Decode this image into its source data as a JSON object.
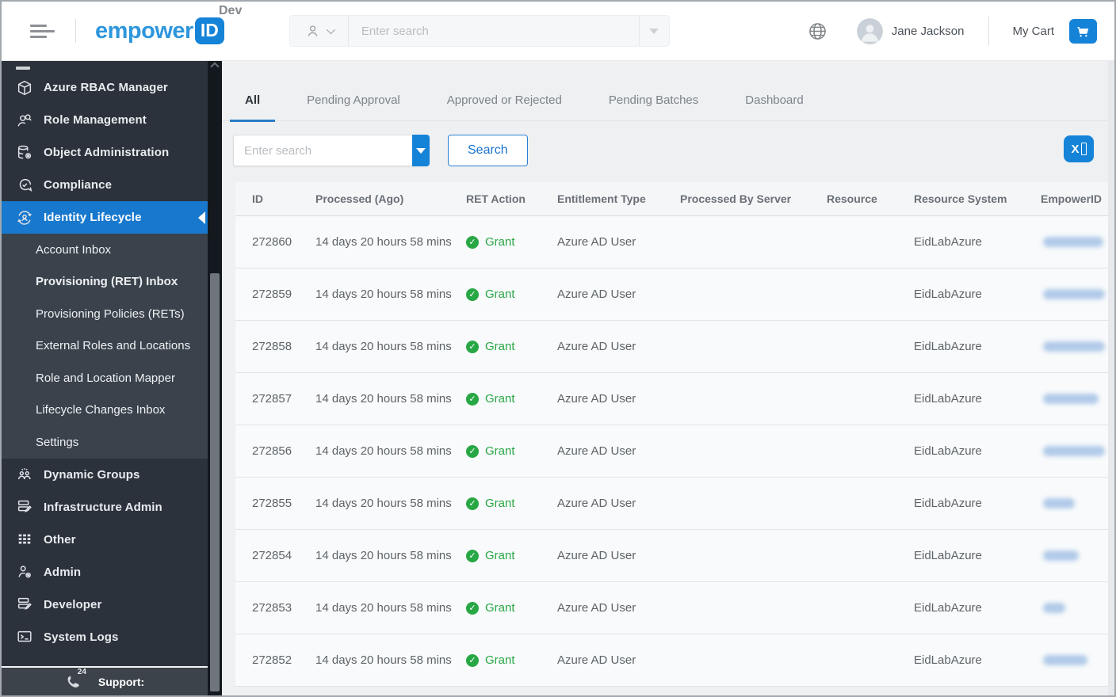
{
  "header": {
    "env_label": "Dev",
    "brand": {
      "text": "empower",
      "badge": "ID"
    },
    "search": {
      "placeholder": "Enter search"
    },
    "user": {
      "name": "Jane Jackson"
    },
    "cart_label": "My Cart"
  },
  "sidebar": {
    "items": [
      {
        "label": "Azure RBAC Manager",
        "icon": "cube-icon",
        "kind": "top"
      },
      {
        "label": "Role Management",
        "icon": "role-search-icon",
        "kind": "top"
      },
      {
        "label": "Object Administration",
        "icon": "database-gear-icon",
        "kind": "top"
      },
      {
        "label": "Compliance",
        "icon": "chat-check-icon",
        "kind": "top"
      },
      {
        "label": "Identity Lifecycle",
        "icon": "identity-cycle-icon",
        "kind": "top",
        "selected": true
      },
      {
        "label": "Account Inbox",
        "kind": "sub"
      },
      {
        "label": "Provisioning (RET) Inbox",
        "kind": "sub",
        "active": true
      },
      {
        "label": "Provisioning Policies (RETs)",
        "kind": "sub"
      },
      {
        "label": "External Roles and Locations",
        "kind": "sub"
      },
      {
        "label": "Role and Location Mapper",
        "kind": "sub"
      },
      {
        "label": "Lifecycle Changes Inbox",
        "kind": "sub"
      },
      {
        "label": "Settings",
        "kind": "sub"
      },
      {
        "label": "Dynamic Groups",
        "icon": "dynamic-groups-icon",
        "kind": "top"
      },
      {
        "label": "Infrastructure Admin",
        "icon": "server-edit-icon",
        "kind": "top"
      },
      {
        "label": "Other",
        "icon": "grid-icon",
        "kind": "top"
      },
      {
        "label": "Admin",
        "icon": "user-gear-icon",
        "kind": "top"
      },
      {
        "label": "Developer",
        "icon": "server-edit-icon",
        "kind": "top"
      },
      {
        "label": "System Logs",
        "icon": "terminal-icon",
        "kind": "top"
      }
    ],
    "support_label": "Support:",
    "support_phone_badge": "24"
  },
  "main": {
    "tabs": [
      {
        "label": "All",
        "active": true
      },
      {
        "label": "Pending Approval"
      },
      {
        "label": "Approved or Rejected"
      },
      {
        "label": "Pending Batches"
      },
      {
        "label": "Dashboard"
      }
    ],
    "toolbar": {
      "search_placeholder": "Enter search",
      "search_button": "Search",
      "excel_glyph": "X"
    }
  },
  "table": {
    "columns": [
      "ID",
      "Processed (Ago)",
      "RET Action",
      "Entitlement Type",
      "Processed By Server",
      "Resource",
      "Resource System",
      "EmpowerID"
    ],
    "status_colors": {
      "grant_green": "#28a745",
      "accent_blue": "#1583d8"
    },
    "rows": [
      {
        "id": "272860",
        "processed_ago": "14 days 20 hours 58 mins",
        "ret_action": "Grant",
        "entitlement_type": "Azure AD User",
        "processed_by_server": "",
        "resource": "",
        "resource_system": "EidLabAzure",
        "empowerid_login_redacted": true,
        "redacted_width": 76
      },
      {
        "id": "272859",
        "processed_ago": "14 days 20 hours 58 mins",
        "ret_action": "Grant",
        "entitlement_type": "Azure AD User",
        "processed_by_server": "",
        "resource": "",
        "resource_system": "EidLabAzure",
        "empowerid_login_redacted": true,
        "redacted_width": 78
      },
      {
        "id": "272858",
        "processed_ago": "14 days 20 hours 58 mins",
        "ret_action": "Grant",
        "entitlement_type": "Azure AD User",
        "processed_by_server": "",
        "resource": "",
        "resource_system": "EidLabAzure",
        "empowerid_login_redacted": true,
        "redacted_width": 78
      },
      {
        "id": "272857",
        "processed_ago": "14 days 20 hours 58 mins",
        "ret_action": "Grant",
        "entitlement_type": "Azure AD User",
        "processed_by_server": "",
        "resource": "",
        "resource_system": "EidLabAzure",
        "empowerid_login_redacted": true,
        "redacted_width": 70
      },
      {
        "id": "272856",
        "processed_ago": "14 days 20 hours 58 mins",
        "ret_action": "Grant",
        "entitlement_type": "Azure AD User",
        "processed_by_server": "",
        "resource": "",
        "resource_system": "EidLabAzure",
        "empowerid_login_redacted": true,
        "redacted_width": 78
      },
      {
        "id": "272855",
        "processed_ago": "14 days 20 hours 58 mins",
        "ret_action": "Grant",
        "entitlement_type": "Azure AD User",
        "processed_by_server": "",
        "resource": "",
        "resource_system": "EidLabAzure",
        "empowerid_login_redacted": true,
        "redacted_width": 40
      },
      {
        "id": "272854",
        "processed_ago": "14 days 20 hours 58 mins",
        "ret_action": "Grant",
        "entitlement_type": "Azure AD User",
        "processed_by_server": "",
        "resource": "",
        "resource_system": "EidLabAzure",
        "empowerid_login_redacted": true,
        "redacted_width": 45
      },
      {
        "id": "272853",
        "processed_ago": "14 days 20 hours 58 mins",
        "ret_action": "Grant",
        "entitlement_type": "Azure AD User",
        "processed_by_server": "",
        "resource": "",
        "resource_system": "EidLabAzure",
        "empowerid_login_redacted": true,
        "redacted_width": 28
      },
      {
        "id": "272852",
        "processed_ago": "14 days 20 hours 58 mins",
        "ret_action": "Grant",
        "entitlement_type": "Azure AD User",
        "processed_by_server": "",
        "resource": "",
        "resource_system": "EidLabAzure",
        "empowerid_login_redacted": true,
        "redacted_width": 56
      }
    ]
  }
}
